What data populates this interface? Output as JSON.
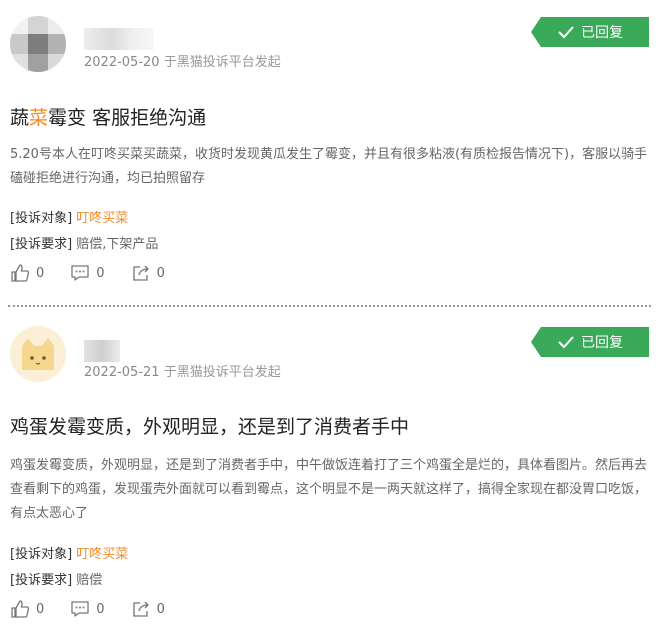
{
  "colors": {
    "accent_green": "#3aa95a",
    "accent_orange": "#f08a24"
  },
  "posts": [
    {
      "date": "2022-05-20",
      "source": "于黑猫投诉平台发起",
      "status": "已回复",
      "title_prefix": "蔬",
      "title_highlight": "菜",
      "title_suffix": "霉变 客服拒绝沟通",
      "body": "5.20号本人在叮咚买菜买蔬菜，收货时发现黄瓜发生了霉变，并且有很多粘液(有质检报告情况下)，客服以骑手磕碰拒绝进行沟通，均已拍照留存",
      "target_label": "[投诉对象]",
      "target_value": "叮咚买菜",
      "demand_label": "[投诉要求]",
      "demand_value": "赔偿,下架产品",
      "likes": "0",
      "comments": "0",
      "shares": "0"
    },
    {
      "date": "2022-05-21",
      "source": "于黑猫投诉平台发起",
      "status": "已回复",
      "title": "鸡蛋发霉变质，外观明显，还是到了消费者手中",
      "body": "鸡蛋发霉变质，外观明显，还是到了消费者手中，中午做饭连着打了三个鸡蛋全是烂的，具体看图片。然后再去查看剩下的鸡蛋，发现蛋壳外面就可以看到霉点，这个明显不是一两天就这样了，搞得全家现在都没胃口吃饭，有点太恶心了",
      "target_label": "[投诉对象]",
      "target_value": "叮咚买菜",
      "demand_label": "[投诉要求]",
      "demand_value": "赔偿",
      "likes": "0",
      "comments": "0",
      "shares": "0"
    }
  ]
}
